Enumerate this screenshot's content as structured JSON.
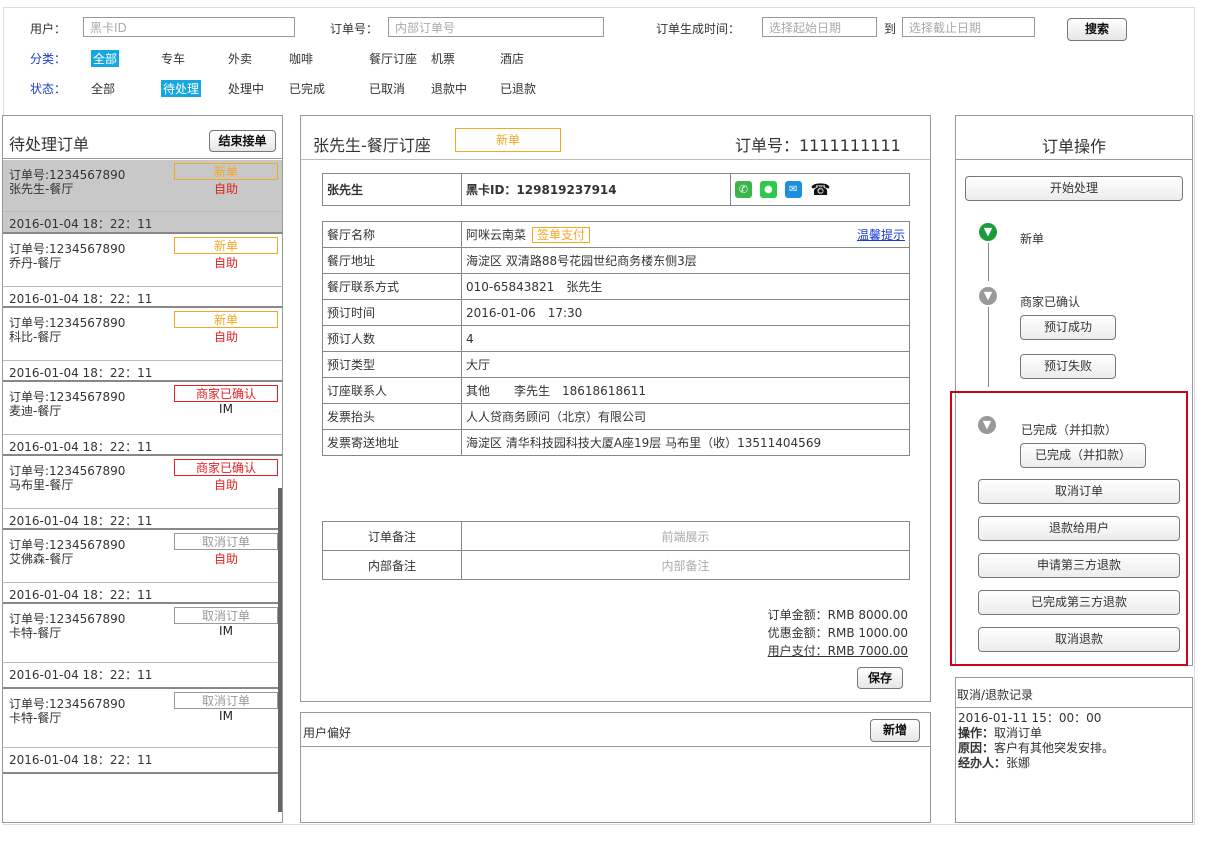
{
  "filters": {
    "user_label": "用户：",
    "user_placeholder": "黑卡ID",
    "order_label": "订单号：",
    "order_placeholder": "内部订单号",
    "time_label": "订单生成时间：",
    "start_placeholder": "选择起始日期",
    "to_label": "到",
    "end_placeholder": "选择截止日期",
    "search_label": "搜索",
    "category_label": "分类：",
    "categories": [
      "全部",
      "专车",
      "外卖",
      "咖啡",
      "餐厅订座",
      "机票",
      "酒店"
    ],
    "status_label": "状态：",
    "statuses": [
      "全部",
      "待处理",
      "处理中",
      "已完成",
      "已取消",
      "退款中",
      "已退款"
    ]
  },
  "left_panel": {
    "title": "待处理订单",
    "end_button": "结束接单",
    "orders": [
      {
        "no": "订单号:1234567890",
        "cust": "张先生-餐厅",
        "status": "新单",
        "mode": "自助",
        "date": "2016-01-04 18：22：11"
      },
      {
        "no": "订单号:1234567890",
        "cust": "乔丹-餐厅",
        "status": "新单",
        "mode": "自助",
        "date": "2016-01-04 18：22：11"
      },
      {
        "no": "订单号:1234567890",
        "cust": "科比-餐厅",
        "status": "新单",
        "mode": "自助",
        "date": "2016-01-04 18：22：11"
      },
      {
        "no": "订单号:1234567890",
        "cust": "麦迪-餐厅",
        "status": "商家已确认",
        "mode": "IM",
        "date": "2016-01-04 18：22：11"
      },
      {
        "no": "订单号:1234567890",
        "cust": "马布里-餐厅",
        "status": "商家已确认",
        "mode": "自助",
        "date": "2016-01-04 18：22：11"
      },
      {
        "no": "订单号:1234567890",
        "cust": "艾佛森-餐厅",
        "status": "取消订单",
        "mode": "自助",
        "date": "2016-01-04 18：22：11"
      },
      {
        "no": "订单号:1234567890",
        "cust": "卡特-餐厅",
        "status": "取消订单",
        "mode": "IM",
        "date": "2016-01-04 18：22：11"
      },
      {
        "no": "订单号:1234567890",
        "cust": "卡特-餐厅",
        "status": "取消订单",
        "mode": "IM",
        "date": "2016-01-04 18：22：11"
      }
    ]
  },
  "detail": {
    "title": "张先生-餐厅订座",
    "badge": "新单",
    "order_no": "订单号：1111111111",
    "customer": "张先生",
    "card_id": "黑卡ID：129819237914",
    "rows": [
      {
        "label": "餐厅名称",
        "value": "阿咪云南菜"
      },
      {
        "label": "餐厅地址",
        "value": "海淀区 双清路88号花园世纪商务楼东侧3层"
      },
      {
        "label": "餐厅联系方式",
        "value": "010-65843821　张先生"
      },
      {
        "label": "预订时间",
        "value": "2016-01-06　17:30"
      },
      {
        "label": "预订人数",
        "value": "4"
      },
      {
        "label": "预订类型",
        "value": "大厅"
      },
      {
        "label": "订座联系人",
        "value": "其他　　李先生　18618618611"
      },
      {
        "label": "发票抬头",
        "value": "人人贷商务顾问（北京）有限公司"
      },
      {
        "label": "发票寄送地址",
        "value": "海淀区 清华科技园科技大厦A座19层 马布里（收）13511404569"
      }
    ],
    "sign_pay": "签单支付",
    "tip_link": "温馨提示",
    "remark_label": "订单备注",
    "remark_value": "前端展示",
    "internal_label": "内部备注",
    "internal_value": "内部备注",
    "amount": "订单金额：RMB 8000.00",
    "discount": "优惠金额：RMB 1000.00",
    "paid": "用户支付：RMB 7000.00",
    "save": "保存"
  },
  "preference": {
    "title": "用户偏好",
    "add": "新增"
  },
  "ops": {
    "title": "订单操作",
    "start": "开始处理",
    "step1": "新单",
    "step2": "商家已确认",
    "book_ok": "预订成功",
    "book_fail": "预订失败",
    "step3": "已完成（并扣款）",
    "done_btn": "已完成（并扣款）",
    "actions": [
      "取消订单",
      "退款给用户",
      "申请第三方退款",
      "已完成第三方退款",
      "取消退款"
    ]
  },
  "log": {
    "title": "取消/退款记录",
    "time": "2016-01-11 15：00：00",
    "op_label": "操作：",
    "op_value": "取消订单",
    "reason_label": "原因：",
    "reason_value": "客户有其他突发安排。",
    "handler_label": "经办人：",
    "handler_value": "张娜"
  },
  "colors": {
    "accent": "#17a7e0",
    "orange": "#f5a623",
    "red": "#e02020",
    "highlight_box": "#d0021b"
  }
}
